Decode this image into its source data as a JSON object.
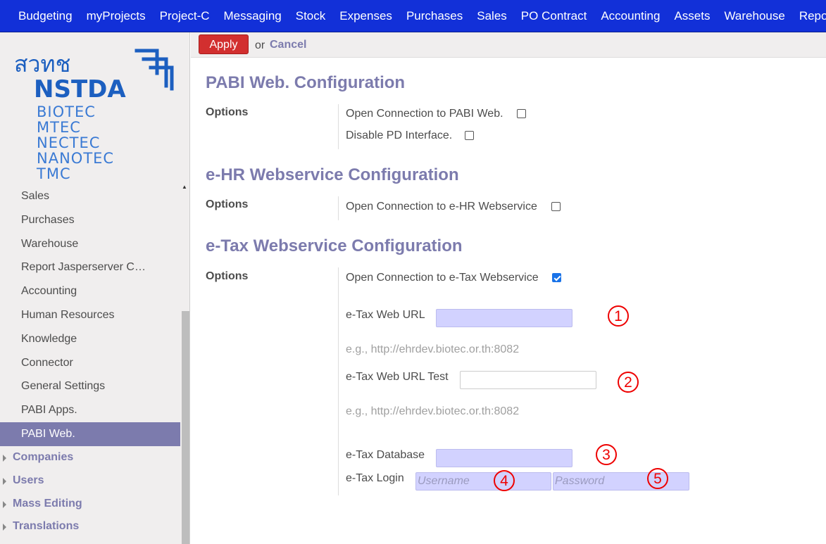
{
  "topnav": [
    "Budgeting",
    "myProjects",
    "Project-C",
    "Messaging",
    "Stock",
    "Expenses",
    "Purchases",
    "Sales",
    "PO Contract",
    "Accounting",
    "Assets",
    "Warehouse",
    "Reporting"
  ],
  "logo": {
    "thai": "สวทช",
    "name": "NSTDA",
    "centers": [
      "BIOTEC",
      "MTEC",
      "NECTEC",
      "NANOTEC",
      "TMC"
    ],
    "color": "#1c5fc0"
  },
  "sidebar": {
    "items": [
      "Sales",
      "Purchases",
      "Warehouse",
      "Report Jasperserver C…",
      "Accounting",
      "Human Resources",
      "Knowledge",
      "Connector",
      "General Settings",
      "PABI Apps.",
      "PABI Web."
    ],
    "active_index": 10,
    "groups": [
      "Companies",
      "Users",
      "Mass Editing",
      "Translations"
    ]
  },
  "actions": {
    "apply": "Apply",
    "or": "or",
    "cancel": "Cancel"
  },
  "sections": {
    "pabi": {
      "title": "PABI Web. Configuration",
      "options_label": "Options",
      "open_conn": "Open Connection to PABI Web.",
      "open_conn_checked": false,
      "disable_pd": "Disable PD Interface.",
      "disable_pd_checked": false
    },
    "ehr": {
      "title": "e-HR Webservice Configuration",
      "options_label": "Options",
      "open_conn": "Open Connection to e-HR Webservice",
      "open_conn_checked": false
    },
    "etax": {
      "title": "e-Tax Webservice Configuration",
      "options_label": "Options",
      "open_conn": "Open Connection to e-Tax Webservice",
      "open_conn_checked": true,
      "web_url_label": "e-Tax Web URL",
      "web_url_value": "",
      "web_url_hint": "e.g., http://ehrdev.biotec.or.th:8082",
      "web_url_test_label": "e-Tax Web URL Test",
      "web_url_test_value": "",
      "web_url_test_hint": "e.g., http://ehrdev.biotec.or.th:8082",
      "database_label": "e-Tax Database",
      "database_value": "",
      "login_label": "e-Tax Login",
      "username_placeholder": "Username",
      "password_placeholder": "Password"
    }
  },
  "markers": [
    "1",
    "2",
    "3",
    "4",
    "5"
  ],
  "colors": {
    "topbar": "#1230d8",
    "accent": "#7c7bad",
    "apply": "#d22f2f",
    "marker": "#e00000",
    "required_field": "#d2d2ff"
  }
}
